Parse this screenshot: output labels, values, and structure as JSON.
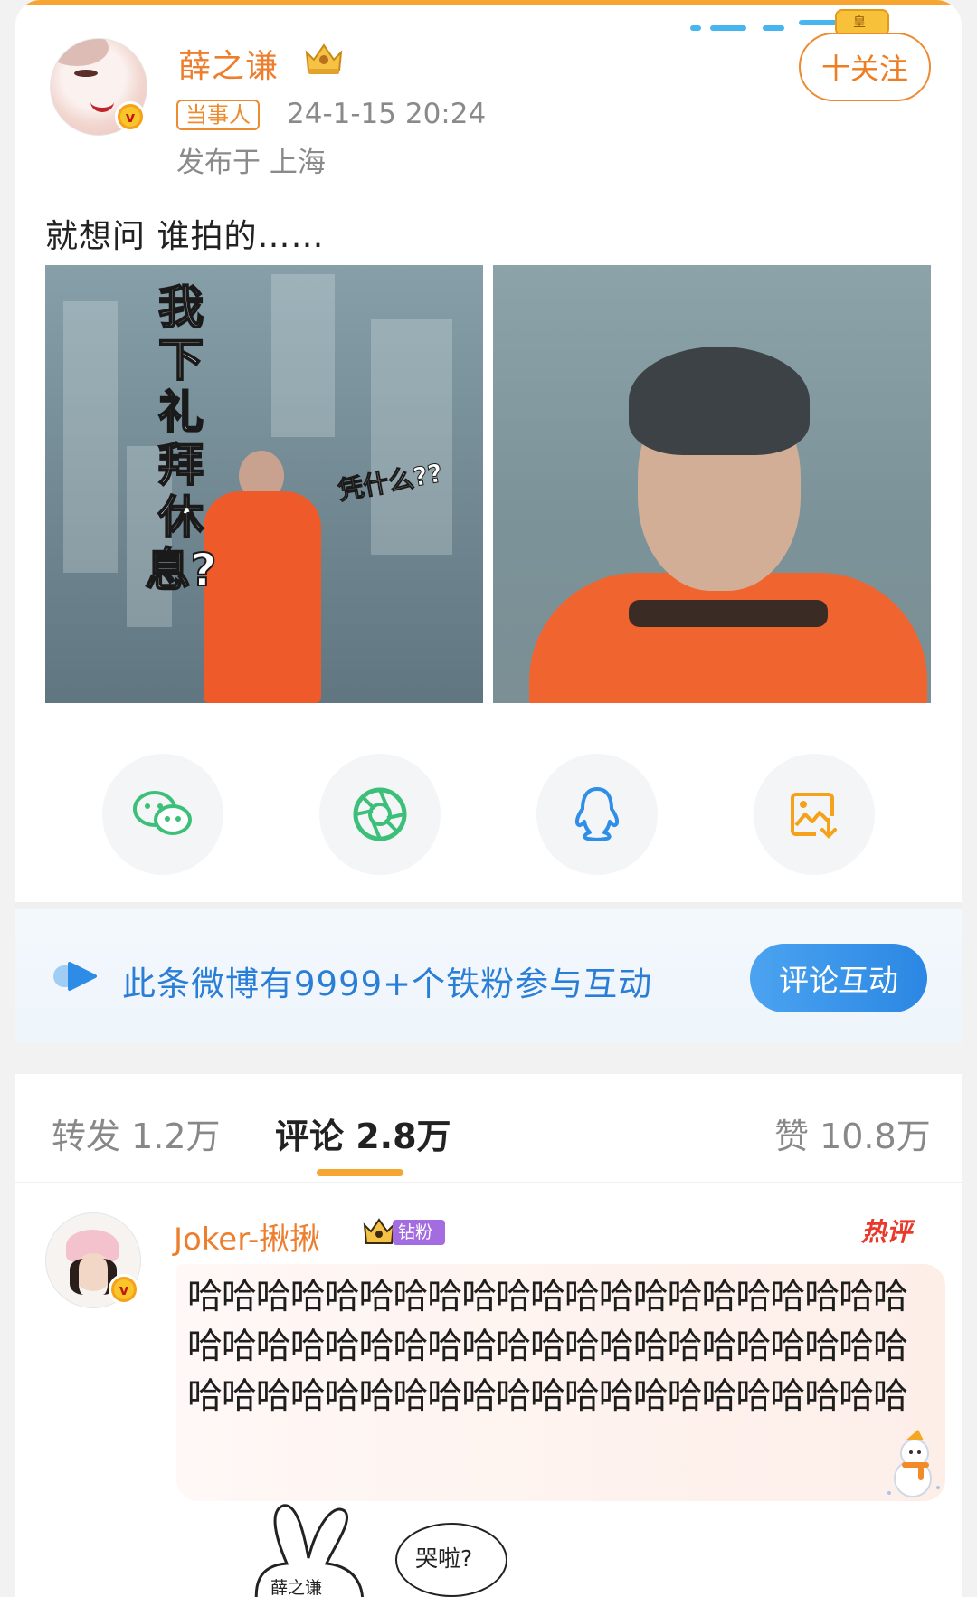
{
  "post": {
    "author_name": "薛之谦",
    "role_tag": "当事人",
    "time": "24-1-15 20:24",
    "location": "发布于 上海",
    "follow_label": "十关注",
    "text": "就想问 谁拍的……",
    "image1_vertical_text": "我下礼拜休息?",
    "image1_side_text": "凭什么??"
  },
  "share": {
    "items": [
      {
        "name": "wechat-icon",
        "color": "#3cbf78"
      },
      {
        "name": "moments-icon",
        "color": "#3cbf78"
      },
      {
        "name": "qq-icon",
        "color": "#2f8ee8"
      },
      {
        "name": "save-image-icon",
        "color": "#f5a11a"
      }
    ]
  },
  "fan_banner": {
    "text": "此条微博有9999+个铁粉参与互动",
    "button_label": "评论互动"
  },
  "tabs": {
    "repost": "转发 1.2万",
    "comment": "评论 2.8万",
    "like": "赞 10.8万"
  },
  "comment": {
    "user_name": "Joker-揪揪",
    "fan_badge": "钻粉3",
    "hot_tag": "热评",
    "text": "哈哈哈哈哈哈哈哈哈哈哈哈哈哈哈哈哈哈哈哈哈哈哈哈哈哈哈哈哈哈哈哈哈哈哈哈哈哈哈哈哈哈哈哈哈哈哈哈哈哈哈哈哈哈哈哈哈哈哈哈哈哈哈"
  },
  "sticker": {
    "bunny_label": "薛之谦",
    "bubble_text": "哭啦?"
  },
  "colors": {
    "accent_orange": "#ed7e2e",
    "link_blue": "#2a7ed6",
    "hot_red": "#e8392b"
  }
}
